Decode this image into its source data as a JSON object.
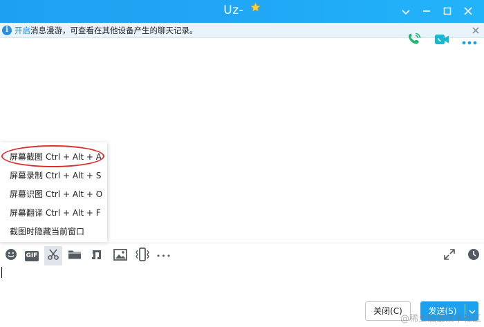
{
  "window": {
    "title": "Uz-",
    "accent": "#1ea0f0"
  },
  "info_bar": {
    "link_text": "开启",
    "message": "消息漫游，可查看在其他设备产生的聊天记录。"
  },
  "screenshot_menu": {
    "items": [
      {
        "label": "屏幕截图 Ctrl + Alt + A"
      },
      {
        "label": "屏幕录制 Ctrl + Alt + S"
      },
      {
        "label": "屏幕识图 Ctrl + Alt + O"
      },
      {
        "label": "屏幕翻译 Ctrl + Alt + F"
      },
      {
        "label": "截图时隐藏当前窗口"
      }
    ],
    "highlight_color": "#d9302c"
  },
  "toolbar": {
    "gif_label": "GIF",
    "more_label": "•••"
  },
  "footer": {
    "close_label": "关闭(C)",
    "send_label": "发送(S)"
  },
  "watermark": "@稀土掘金技术社区"
}
